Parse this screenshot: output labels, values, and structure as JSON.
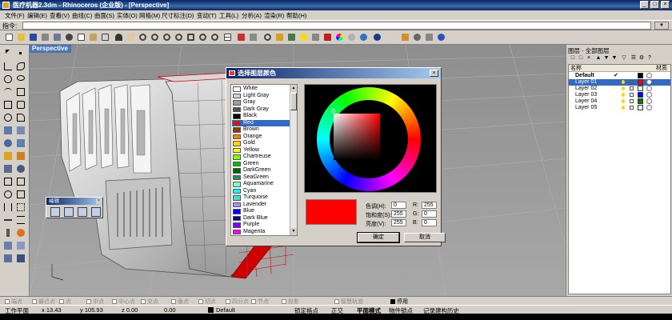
{
  "window": {
    "title": "医疗机器2.3dm - Rhinoceros (企业版) - [Perspective]",
    "controls": [
      "_",
      "□",
      "×"
    ]
  },
  "menu": [
    "文件(F)",
    "编辑(E)",
    "查看(V)",
    "曲线(C)",
    "曲面(S)",
    "实体(O)",
    "网格(M)",
    "尺寸标注(D)",
    "变动(T)",
    "工具(L)",
    "分析(A)",
    "渲染(R)",
    "帮助(H)"
  ],
  "command": {
    "label": "指令:",
    "value": ""
  },
  "viewport": {
    "name": "Perspective"
  },
  "floating_toolbar": {
    "title": "编辑"
  },
  "dialog": {
    "title": "选择图层颜色",
    "colors": [
      {
        "name": "White",
        "color": "#ffffff"
      },
      {
        "name": "Light Gray",
        "color": "#d3d3d3"
      },
      {
        "name": "Gray",
        "color": "#a0a0a0"
      },
      {
        "name": "Dark Gray",
        "color": "#505050"
      },
      {
        "name": "Black",
        "color": "#000000"
      },
      {
        "name": "Red",
        "color": "#ff0000"
      },
      {
        "name": "Brown",
        "color": "#8b3a0a"
      },
      {
        "name": "Orange",
        "color": "#ff8000"
      },
      {
        "name": "Gold",
        "color": "#ffd700"
      },
      {
        "name": "Yellow",
        "color": "#ffff00"
      },
      {
        "name": "Chartreuse",
        "color": "#80ff00"
      },
      {
        "name": "Green",
        "color": "#00c000"
      },
      {
        "name": "DarkGreen",
        "color": "#006400"
      },
      {
        "name": "SeaGreen",
        "color": "#2e8b57"
      },
      {
        "name": "Aquamarine",
        "color": "#7fffd4"
      },
      {
        "name": "Cyan",
        "color": "#00ffff"
      },
      {
        "name": "Turquoise",
        "color": "#40e0d0"
      },
      {
        "name": "Lavender",
        "color": "#b48cff"
      },
      {
        "name": "Blue",
        "color": "#0000ff"
      },
      {
        "name": "Dark Blue",
        "color": "#00008b"
      },
      {
        "name": "Purple",
        "color": "#8000ff"
      },
      {
        "name": "Magenta",
        "color": "#ff00ff"
      }
    ],
    "selected_color": "Red",
    "fields": {
      "hue_label": "色调(H):",
      "hue": "0",
      "sat_label": "饱和度(S):",
      "sat": "255",
      "val_label": "亮度(V):",
      "val": "255",
      "r_label": "R:",
      "r": "255",
      "g_label": "G:",
      "g": "0",
      "b_label": "B:",
      "b": "0"
    },
    "ok_label": "确定",
    "cancel_label": "取消",
    "preview_color": "#ff0000"
  },
  "layers": {
    "title": "图层 - 全部图层",
    "col_name": "名称",
    "col_material": "材质",
    "rows": [
      {
        "name": "Default",
        "color": "#000000",
        "current": true,
        "selected": false
      },
      {
        "name": "Layer 01",
        "color": "#ff0000",
        "current": false,
        "selected": true
      },
      {
        "name": "Layer 02",
        "color": "#ffffff",
        "current": false,
        "selected": false
      },
      {
        "name": "Layer 03",
        "color": "#0000ff",
        "current": false,
        "selected": false
      },
      {
        "name": "Layer 04",
        "color": "#008000",
        "current": false,
        "selected": false
      },
      {
        "name": "Layer 05",
        "color": "#ffffff",
        "current": false,
        "selected": false
      }
    ],
    "current_mark": "✔"
  },
  "osnaps": [
    {
      "label": "端点",
      "on": false
    },
    {
      "label": "最近点",
      "on": false
    },
    {
      "label": "点",
      "on": false
    },
    {
      "label": "中点",
      "on": false
    },
    {
      "label": "中心点",
      "on": false
    },
    {
      "label": "交点",
      "on": false
    },
    {
      "label": "垂点",
      "on": false
    },
    {
      "label": "切点",
      "on": false
    },
    {
      "label": "四分点",
      "on": false
    },
    {
      "label": "节点",
      "on": false
    },
    {
      "label": "投影",
      "on": false
    },
    {
      "label": "智慧轨迹",
      "on": false
    },
    {
      "label": "停用",
      "on": true
    }
  ],
  "status": {
    "cplane": "工作平面",
    "x": "x 13.43",
    "y": "y 105.93",
    "z": "z 0.00",
    "extra": "0.00",
    "layer": "Default",
    "grid_snap": "锁定格点",
    "ortho": "正交",
    "planar": "平面模式",
    "osnap": "物件锁点",
    "history": "记录建构历史"
  }
}
